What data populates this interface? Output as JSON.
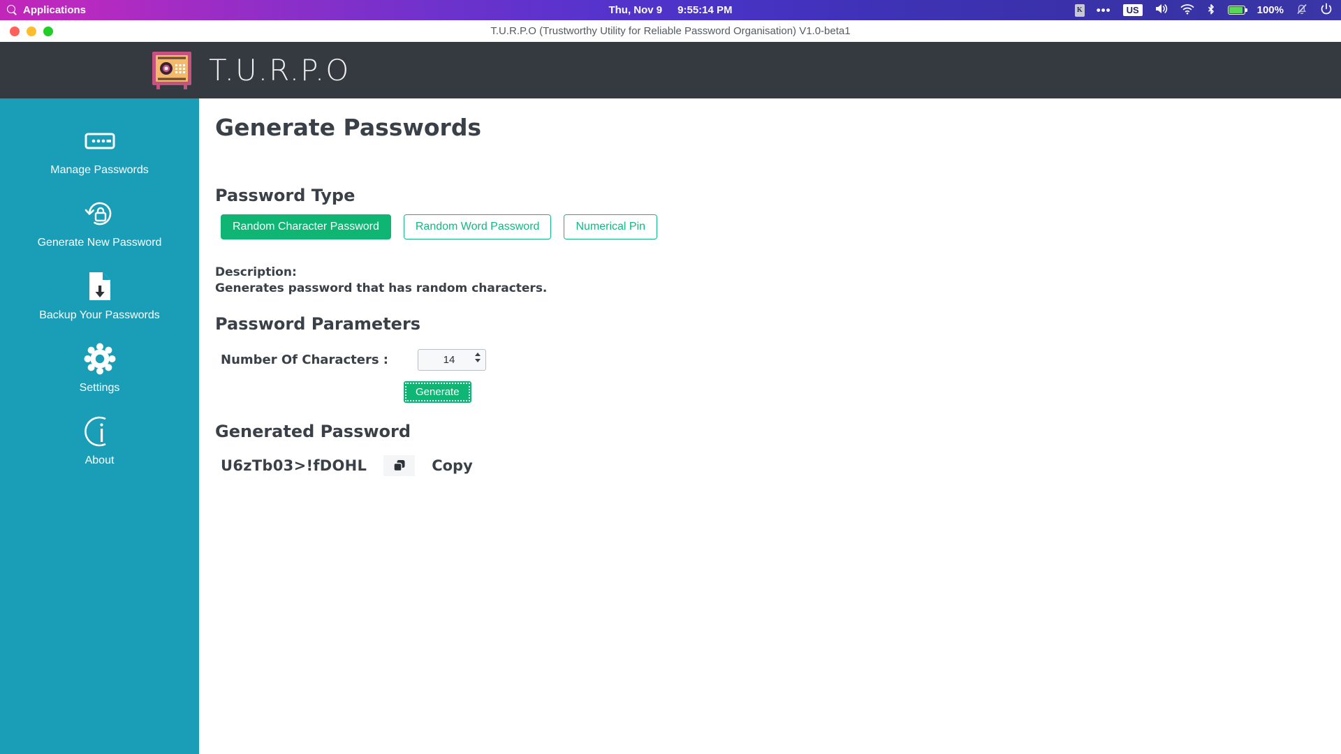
{
  "system_bar": {
    "applications_label": "Applications",
    "search_icon": "search-icon",
    "clock_date": "Thu, Nov  9",
    "clock_time": "9:55:14 PM",
    "tray": {
      "keyboard_indicator": "K",
      "overflow_dots": "•••",
      "keyboard_layout": "US",
      "volume_icon": "speaker-icon",
      "wifi_icon": "wifi-icon",
      "bluetooth_icon": "bluetooth-icon",
      "battery_icon": "battery-icon",
      "battery_percent": "100%",
      "notifications_icon": "bell-off-icon",
      "power_icon": "power-icon"
    }
  },
  "window": {
    "title": "T.U.R.P.O (Trustworthy Utility for Reliable Password Organisation) V1.0-beta1",
    "close_button": "close",
    "minimize_button": "minimize",
    "maximize_button": "maximize"
  },
  "app_header": {
    "brand": "T.U.R.P.O",
    "logo_icon": "safe-vault-icon",
    "background_color": "#343a40"
  },
  "sidebar": {
    "background_color": "#1a9eb7",
    "items": [
      {
        "label": "Manage Passwords",
        "icon": "password-field-icon"
      },
      {
        "label": "Generate New Password",
        "icon": "lock-refresh-icon"
      },
      {
        "label": "Backup Your Passwords",
        "icon": "file-download-icon"
      },
      {
        "label": "Settings",
        "icon": "gear-icon"
      },
      {
        "label": "About",
        "icon": "info-circle-icon"
      }
    ]
  },
  "main": {
    "page_title": "Generate Passwords",
    "password_type": {
      "heading": "Password Type",
      "accent_color": "#0fb573",
      "options": [
        {
          "label": "Random Character Password",
          "selected": true
        },
        {
          "label": "Random Word Password",
          "selected": false
        },
        {
          "label": "Numerical Pin",
          "selected": false
        }
      ]
    },
    "description": {
      "label": "Description:",
      "text": "Generates password that has random characters."
    },
    "parameters": {
      "heading": "Password Parameters",
      "number_of_characters_label": "Number Of Characters :",
      "number_of_characters_value": "14"
    },
    "generate_button": "Generate",
    "generated": {
      "heading": "Generated Password",
      "password": "U6zTb03>!fDOHL",
      "copy_icon": "copy-icon",
      "copy_label": "Copy"
    }
  }
}
